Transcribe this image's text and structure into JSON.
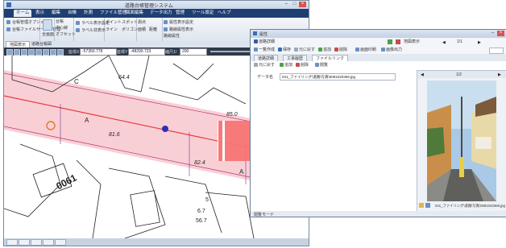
{
  "map_window": {
    "title": "道路台帳管理システム",
    "tabs": [
      "ホーム",
      "表示",
      "編集",
      "台帳",
      "計測",
      "ファイル管理",
      "図面編集",
      "データ出力",
      "管理",
      "ツール設定",
      "ヘルプ"
    ],
    "active_tab": 0,
    "ribbon": {
      "group1": [
        "台帳管理オプション",
        "台帳ファイルサーバー管理"
      ],
      "group2_big": "全画面",
      "group3": [
        "台帳",
        "中心線",
        "オフセット"
      ],
      "group4": [
        "ラベル表示設定",
        "ラベル非表示"
      ],
      "group5": [
        "ポイント",
        "スポット",
        "ライン",
        "ポリゴン"
      ],
      "group6": [
        "測点",
        "面積",
        "距離"
      ],
      "group7": [
        "属性表示設定",
        "路線属性表示",
        "路線属性"
      ]
    },
    "doc_tabs": [
      "地図表示",
      "道路台帳図"
    ],
    "coord_bar": {
      "label_x": "座標X",
      "value_x": "-57350.778",
      "label_y": "座標Y",
      "value_y": "-48290.723",
      "label_scale": "縮尺1/",
      "value_scale": "200"
    },
    "map_labels": {
      "parcel_c": "C",
      "elevation_1": "64.4",
      "elevation_2": "81.6",
      "elevation_3": "85.0",
      "elevation_4": "82.4",
      "parcel_a1": "A",
      "parcel_a2": "A",
      "lot_number": "0061",
      "sub_lot": "5",
      "small_1": "6.7",
      "small_2": "56.7"
    }
  },
  "sub_window": {
    "title": "属性",
    "toolbar1": {
      "record": "道路詳細",
      "page": "1/1",
      "right_btn": "地図表示"
    },
    "toolbar2": [
      "一覧作成",
      "保存",
      "元に戻す",
      "追加",
      "削除",
      "画面印刷",
      "画像出力"
    ],
    "tabs": [
      "道路詳細",
      "工事履歴",
      "ファイルリンク"
    ],
    "active_tab": 2,
    "toolbar3": [
      "元に戻す",
      "追加",
      "削除",
      "閲覧"
    ],
    "field_label": "データ名",
    "field_value": "041_ファイリング\\道路\\写真\\0081020369.jpg",
    "photo_counter": "1/2",
    "photo_caption": "041_ファイリング\\道路\\写真\\0081020369.jpg",
    "status": "閲覧モード"
  },
  "colors": {
    "road_band": "#f8c7cf",
    "road_line": "#e83a3a",
    "arrow": "#f87474",
    "ribbon_dark": "#1f3f73"
  }
}
